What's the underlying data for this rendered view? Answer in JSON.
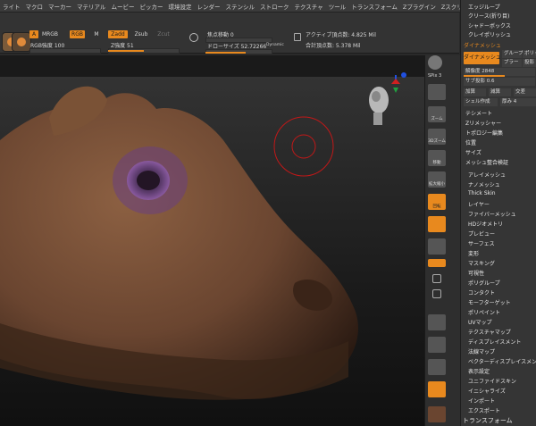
{
  "menubar": [
    "ライト",
    "マクロ",
    "マーカー",
    "マテリアル",
    "ムービー",
    "ピッカー",
    "環境設定",
    "レンダー",
    "ステンシル",
    "ストローク",
    "テクスチャ",
    "ツール",
    "トランスフォーム",
    "Zプラグイン",
    "Zスクリプト"
  ],
  "toolbar": {
    "a_label": "A",
    "mrgb_label": "MRGB",
    "rgb_label": "RGB",
    "m_label": "M",
    "zadd_label": "Zadd",
    "zsub_label": "Zsub",
    "zcut_label": "Zcut",
    "rgb_intensity": "RGB強度 100",
    "z_intensity": "Z強度 51",
    "focal_shift": "焦点移動 0",
    "draw_size": "ドローサイズ 52.72266",
    "dynamic": "Dynamic",
    "active_points": "アクティブ頂点数: 4.825 Mil",
    "total_points": "合計頂点数: 5.378 Mil"
  },
  "shelf": {
    "spix": "SPix 3",
    "items": [
      "",
      "ズーム",
      "3Dズーム",
      "移動",
      "拡大縮小",
      "回転",
      "",
      "",
      "",
      "",
      "",
      "",
      "",
      "",
      "",
      "",
      "",
      "Dynamic"
    ]
  },
  "palette": {
    "top_items": [
      "エッジループ",
      "クリース(折り目)",
      "シャドーボックス",
      "クレイポリッシュ"
    ],
    "dynamesh_header": "ダイナメッシュ",
    "dynamesh_button": "ダイナメッシュ",
    "group_label": "グループ",
    "blur_label": "ブラー",
    "polish_label": "ポリッシュ",
    "project_label": "投影",
    "resolution": "解像度 2848",
    "subproject": "サブ投影 0.6",
    "add_label": "加算",
    "sub_label": "減算",
    "intersect_label": "交差",
    "shell_label": "シェル作成",
    "thickness_label": "厚み 4",
    "items": [
      "テシメート",
      "Zリメッシャー",
      "トポロジー編集",
      "位置",
      "サイズ",
      "メッシュ整合検証"
    ],
    "sub_palettes": [
      "アレイメッシュ",
      "ナノメッシュ",
      "Thick Skin",
      "レイヤー",
      "ファイバーメッシュ",
      "HDジオメトリ",
      "プレビュー",
      "サーフェス",
      "変形",
      "マスキング",
      "可視性",
      "ポリグループ",
      "コンタクト",
      "モーフターゲット",
      "ポリペイント",
      "UVマップ",
      "テクスチャマップ",
      "ディスプレイスメント",
      "法線マップ",
      "ベクターディスプレイスメント",
      "表示設定",
      "ユニファイドスキン",
      "イニシャライズ",
      "インポート",
      "エクスポート"
    ],
    "transform_header": "トランスフォーム"
  },
  "colors": {
    "accent": "#e8891e",
    "panel": "#353535",
    "skin": "#7a5236",
    "eye": "#7a4a8a",
    "brush_cursor": "#c01818"
  }
}
